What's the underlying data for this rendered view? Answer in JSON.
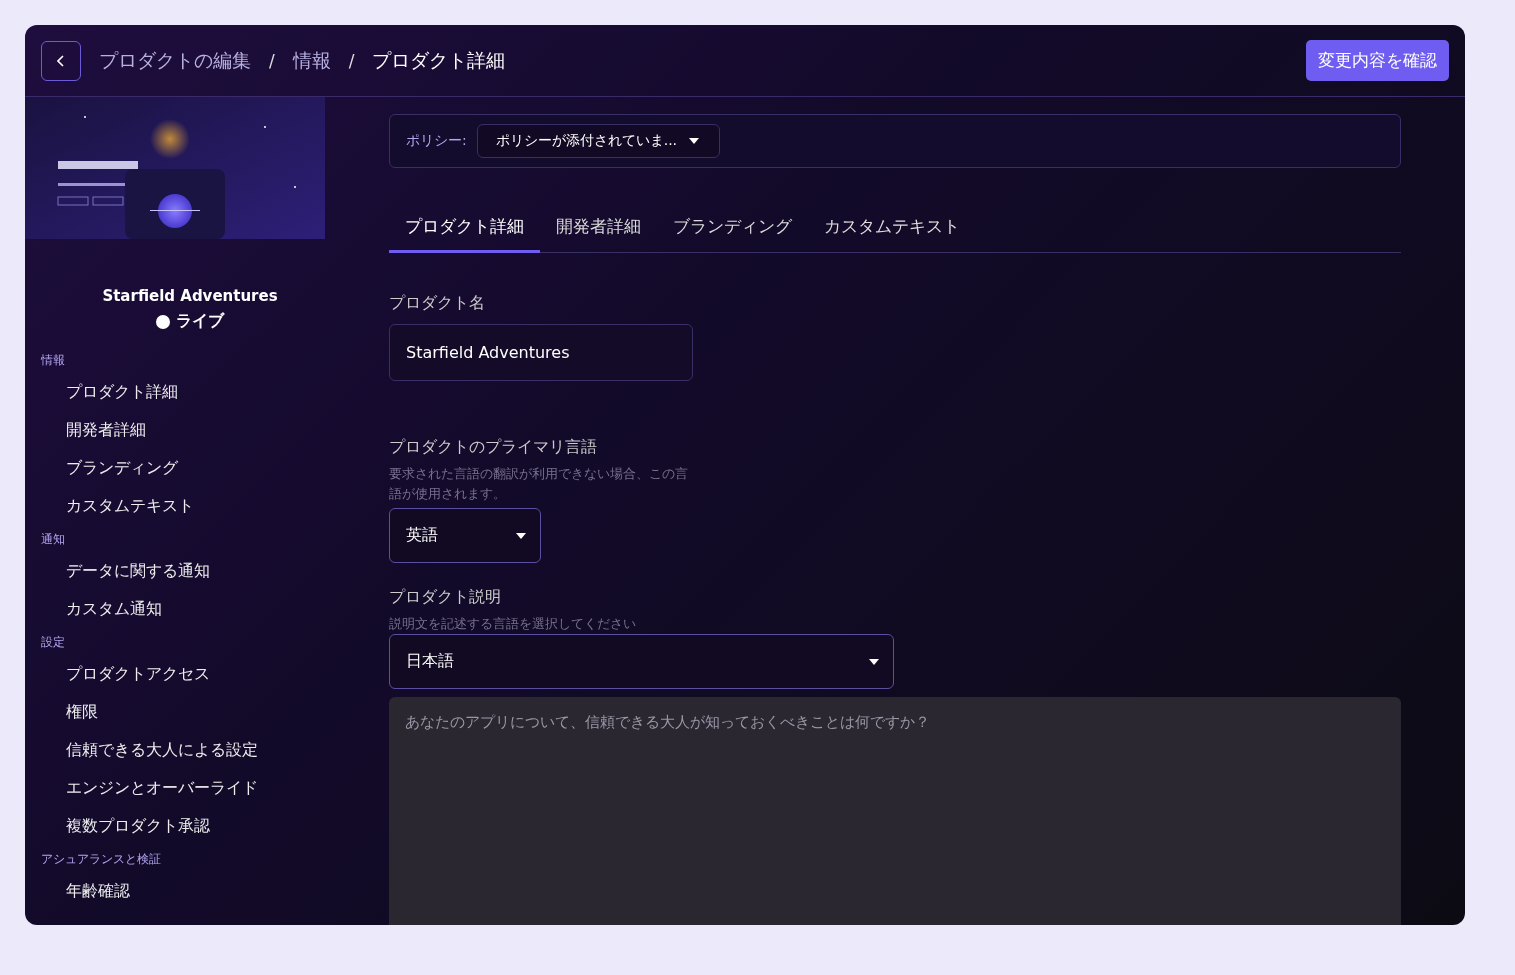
{
  "header": {
    "breadcrumbs": [
      {
        "label": "プロダクトの編集"
      },
      {
        "label": "情報"
      },
      {
        "label": "プロダクト詳細"
      }
    ],
    "separator": "/",
    "confirm_button": "変更内容を確認"
  },
  "sidebar": {
    "product_name": "Starfield Adventures",
    "status": {
      "label": "ライブ",
      "color": "#ffffff"
    },
    "sections": [
      {
        "title": "情報",
        "items": [
          {
            "label": "プロダクト詳細"
          },
          {
            "label": "開発者詳細"
          },
          {
            "label": "ブランディング"
          },
          {
            "label": "カスタムテキスト"
          }
        ]
      },
      {
        "title": "通知",
        "items": [
          {
            "label": "データに関する通知"
          },
          {
            "label": "カスタム通知"
          }
        ]
      },
      {
        "title": "設定",
        "items": [
          {
            "label": "プロダクトアクセス"
          },
          {
            "label": "権限"
          },
          {
            "label": "信頼できる大人による設定"
          },
          {
            "label": "エンジンとオーバーライド"
          },
          {
            "label": "複数プロダクト承認"
          }
        ]
      },
      {
        "title": "アシュアランスと検証",
        "items": [
          {
            "label": "年齢確認"
          }
        ]
      }
    ]
  },
  "policy": {
    "label": "ポリシー:",
    "value": "ポリシーが添付されていま..."
  },
  "tabs": [
    {
      "label": "プロダクト詳細",
      "selected": true
    },
    {
      "label": "開発者詳細",
      "selected": false
    },
    {
      "label": "ブランディング",
      "selected": false
    },
    {
      "label": "カスタムテキスト",
      "selected": false
    }
  ],
  "form": {
    "name": {
      "label": "プロダクト名",
      "value": "Starfield Adventures"
    },
    "language": {
      "label": "プロダクトのプライマリ言語",
      "hint": "要求された言語の翻訳が利用できない場合、この言語が使用されます。",
      "value": "英語"
    },
    "description": {
      "label": "プロダクト説明",
      "hint": "説明文を記述する言語を選択してください",
      "language": "日本語",
      "placeholder": "あなたのアプリについて、信頼できる大人が知っておくべきことは何ですか？"
    }
  }
}
